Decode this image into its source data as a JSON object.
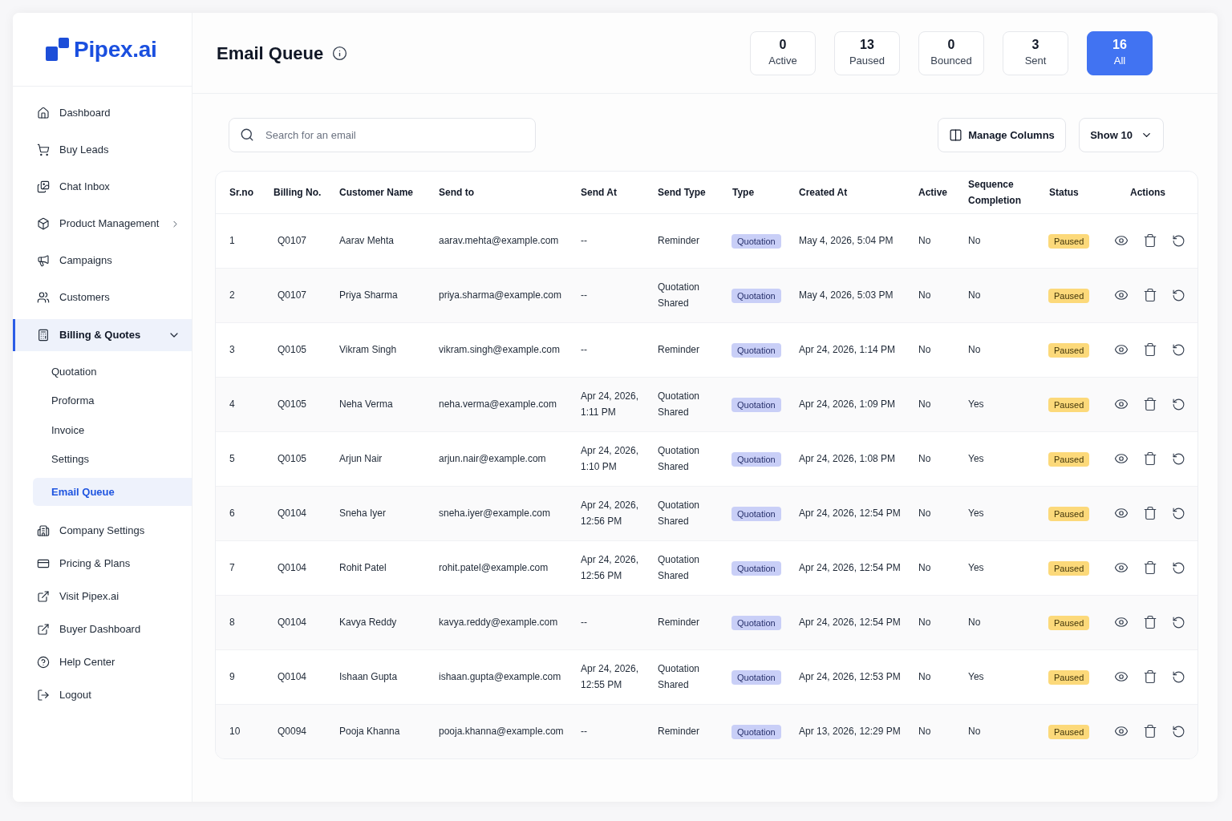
{
  "sidebar": {
    "logo": "Pipex.ai",
    "items": [
      {
        "label": "Dashboard",
        "kind": "link",
        "selected": false
      },
      {
        "label": "Buy Leads",
        "kind": "link",
        "selected": false
      },
      {
        "label": "Chat Inbox",
        "kind": "link",
        "selected": false
      },
      {
        "label": "Product Management",
        "kind": "group",
        "selected": false,
        "expanded": false
      },
      {
        "label": "Campaigns",
        "kind": "link",
        "selected": false
      },
      {
        "label": "Customers",
        "kind": "link",
        "selected": false
      },
      {
        "label": "Billing & Quotes",
        "kind": "group",
        "selected": true,
        "expanded": true,
        "children": [
          {
            "label": "Quotation",
            "selected": false
          },
          {
            "label": "Proforma",
            "selected": false
          },
          {
            "label": "Invoice",
            "selected": false
          },
          {
            "label": "Settings",
            "selected": false
          },
          {
            "label": "Email Queue",
            "selected": true
          }
        ]
      },
      {
        "label": "Company Settings",
        "kind": "link",
        "selected": false
      },
      {
        "label": "Pricing & Plans",
        "kind": "link",
        "selected": false
      },
      {
        "label": "Visit Pipex.ai",
        "kind": "link",
        "selected": false
      },
      {
        "label": "Buyer Dashboard",
        "kind": "link",
        "selected": false
      },
      {
        "label": "Help Center",
        "kind": "link",
        "selected": false
      },
      {
        "label": "Logout",
        "kind": "link",
        "selected": false
      }
    ]
  },
  "header": {
    "title": "Email Queue",
    "filters": [
      {
        "count": "0",
        "label": "Active",
        "selected": false
      },
      {
        "count": "13",
        "label": "Paused",
        "selected": false
      },
      {
        "count": "0",
        "label": "Bounced",
        "selected": false
      },
      {
        "count": "3",
        "label": "Sent",
        "selected": false
      },
      {
        "count": "16",
        "label": "All",
        "selected": true
      }
    ]
  },
  "toolbar": {
    "search": {
      "placeholder": "Search for an email"
    },
    "manage_columns": "Manage Columns",
    "page_size": "Show 10"
  },
  "table": {
    "columns": [
      "Sr.no",
      "Billing No.",
      "Customer Name",
      "Send to",
      "Send At",
      "Send Type",
      "Type",
      "Created At",
      "Active",
      "Sequence Completion",
      "Status",
      "Actions"
    ],
    "rows": [
      {
        "sr_no": "1",
        "billing_no": "Q0107",
        "customer_name": "Aarav Mehta",
        "send_to": "aarav.mehta@example.com",
        "send_at": "--",
        "send_type": "Reminder",
        "type": "Quotation",
        "created_at": "May 4, 2026, 5:04 PM",
        "active": "No",
        "sequence_completion": "No",
        "status": "Paused"
      },
      {
        "sr_no": "2",
        "billing_no": "Q0107",
        "customer_name": "Priya Sharma",
        "send_to": "priya.sharma@example.com",
        "send_at": "--",
        "send_type": "Quotation Shared",
        "type": "Quotation",
        "created_at": "May 4, 2026, 5:03 PM",
        "active": "No",
        "sequence_completion": "No",
        "status": "Paused"
      },
      {
        "sr_no": "3",
        "billing_no": "Q0105",
        "customer_name": "Vikram Singh",
        "send_to": "vikram.singh@example.com",
        "send_at": "--",
        "send_type": "Reminder",
        "type": "Quotation",
        "created_at": "Apr 24, 2026, 1:14 PM",
        "active": "No",
        "sequence_completion": "No",
        "status": "Paused"
      },
      {
        "sr_no": "4",
        "billing_no": "Q0105",
        "customer_name": "Neha Verma",
        "send_to": "neha.verma@example.com",
        "send_at": "Apr 24, 2026, 1:11 PM",
        "send_type": "Quotation Shared",
        "type": "Quotation",
        "created_at": "Apr 24, 2026, 1:09 PM",
        "active": "No",
        "sequence_completion": "Yes",
        "status": "Paused"
      },
      {
        "sr_no": "5",
        "billing_no": "Q0105",
        "customer_name": "Arjun Nair",
        "send_to": "arjun.nair@example.com",
        "send_at": "Apr 24, 2026, 1:10 PM",
        "send_type": "Quotation Shared",
        "type": "Quotation",
        "created_at": "Apr 24, 2026, 1:08 PM",
        "active": "No",
        "sequence_completion": "Yes",
        "status": "Paused"
      },
      {
        "sr_no": "6",
        "billing_no": "Q0104",
        "customer_name": "Sneha Iyer",
        "send_to": "sneha.iyer@example.com",
        "send_at": "Apr 24, 2026, 12:56 PM",
        "send_type": "Quotation Shared",
        "type": "Quotation",
        "created_at": "Apr 24, 2026, 12:54 PM",
        "active": "No",
        "sequence_completion": "Yes",
        "status": "Paused"
      },
      {
        "sr_no": "7",
        "billing_no": "Q0104",
        "customer_name": "Rohit Patel",
        "send_to": "rohit.patel@example.com",
        "send_at": "Apr 24, 2026, 12:56 PM",
        "send_type": "Quotation Shared",
        "type": "Quotation",
        "created_at": "Apr 24, 2026, 12:54 PM",
        "active": "No",
        "sequence_completion": "Yes",
        "status": "Paused"
      },
      {
        "sr_no": "8",
        "billing_no": "Q0104",
        "customer_name": "Kavya Reddy",
        "send_to": "kavya.reddy@example.com",
        "send_at": "--",
        "send_type": "Reminder",
        "type": "Quotation",
        "created_at": "Apr 24, 2026, 12:54 PM",
        "active": "No",
        "sequence_completion": "No",
        "status": "Paused"
      },
      {
        "sr_no": "9",
        "billing_no": "Q0104",
        "customer_name": "Ishaan Gupta",
        "send_to": "ishaan.gupta@example.com",
        "send_at": "Apr 24, 2026, 12:55 PM",
        "send_type": "Quotation Shared",
        "type": "Quotation",
        "created_at": "Apr 24, 2026, 12:53 PM",
        "active": "No",
        "sequence_completion": "Yes",
        "status": "Paused"
      },
      {
        "sr_no": "10",
        "billing_no": "Q0094",
        "customer_name": "Pooja Khanna",
        "send_to": "pooja.khanna@example.com",
        "send_at": "--",
        "send_type": "Reminder",
        "type": "Quotation",
        "created_at": "Apr 13, 2026, 12:29 PM",
        "active": "No",
        "sequence_completion": "No",
        "status": "Paused"
      }
    ]
  }
}
